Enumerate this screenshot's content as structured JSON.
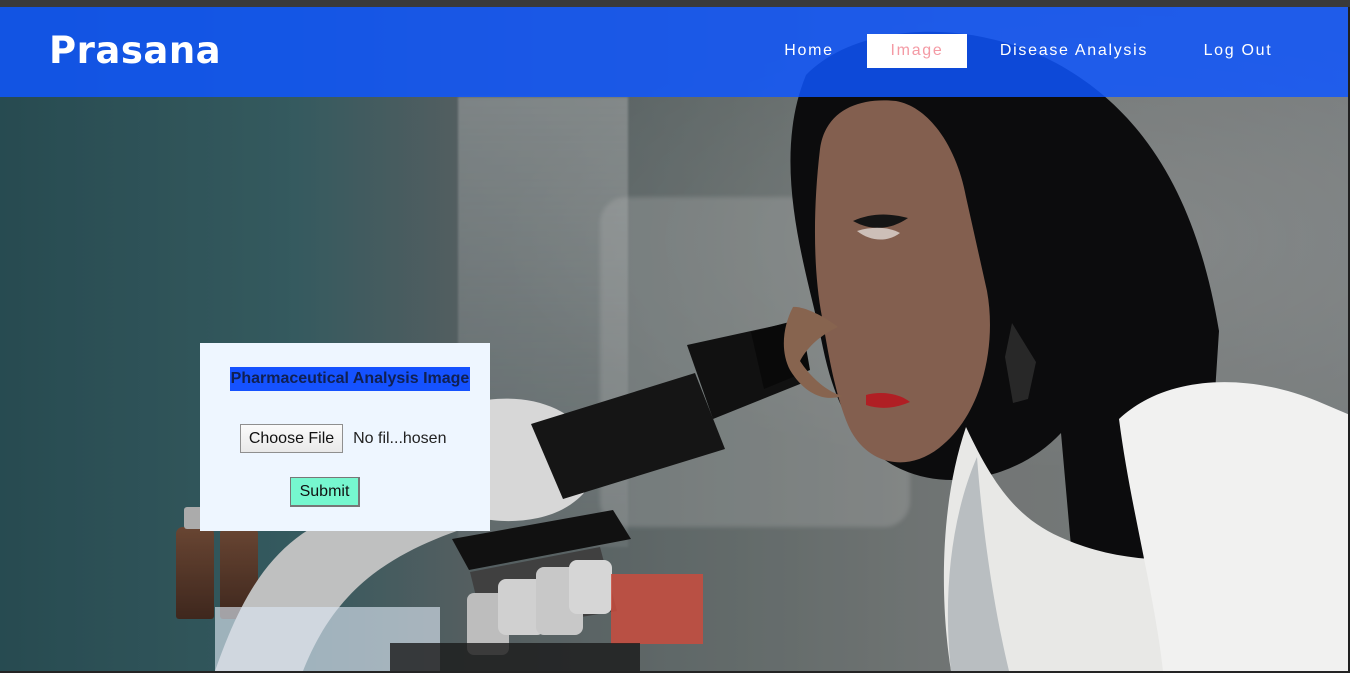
{
  "brand": {
    "name": "Prasana"
  },
  "nav": {
    "items": [
      {
        "label": "Home",
        "state": "default"
      },
      {
        "label": "Image",
        "state": "active"
      },
      {
        "label": "Disease Analysis",
        "state": "default"
      },
      {
        "label": "Log Out",
        "state": "default"
      }
    ]
  },
  "upload_card": {
    "title": "Pharmaceutical Analysis Image",
    "file_button_label": "Choose File",
    "file_status": "No fil...hosen",
    "submit_label": "Submit"
  },
  "theme": {
    "navbar_color": "#1552ff",
    "active_nav_text_color": "#f49aa4",
    "card_background": "#eef6ff",
    "submit_background": "#76f7cf"
  },
  "icons": [
    "microscope-image",
    "scientist-image"
  ]
}
